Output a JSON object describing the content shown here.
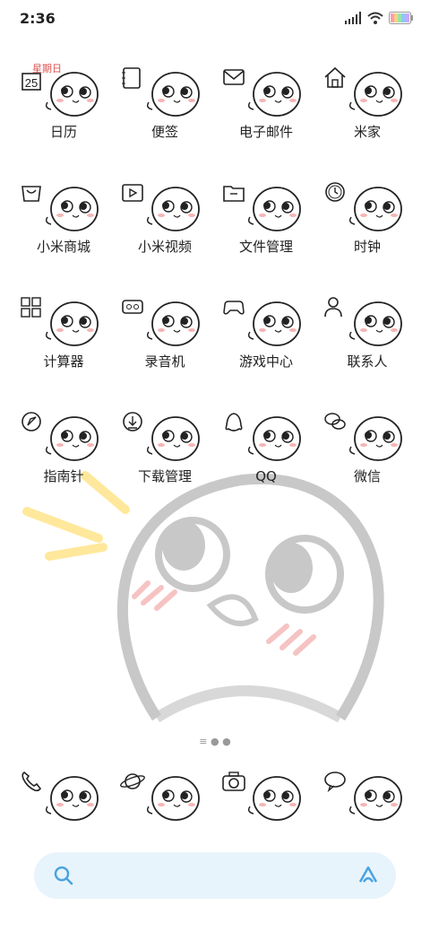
{
  "status_bar": {
    "time": "2:36"
  },
  "calendar_date": "星期日",
  "calendar_day": "25",
  "apps": [
    {
      "label": "日历",
      "icon": "calendar-icon"
    },
    {
      "label": "便签",
      "icon": "notes-icon"
    },
    {
      "label": "电子邮件",
      "icon": "mail-icon"
    },
    {
      "label": "米家",
      "icon": "home-icon"
    },
    {
      "label": "小米商城",
      "icon": "shopping-bag-icon"
    },
    {
      "label": "小米视频",
      "icon": "video-icon"
    },
    {
      "label": "文件管理",
      "icon": "folder-icon"
    },
    {
      "label": "时钟",
      "icon": "clock-icon"
    },
    {
      "label": "计算器",
      "icon": "calculator-icon"
    },
    {
      "label": "录音机",
      "icon": "recorder-icon"
    },
    {
      "label": "游戏中心",
      "icon": "gamepad-icon"
    },
    {
      "label": "联系人",
      "icon": "contacts-icon"
    },
    {
      "label": "指南针",
      "icon": "compass-icon"
    },
    {
      "label": "下载管理",
      "icon": "download-icon"
    },
    {
      "label": "QQ",
      "icon": "qq-icon"
    },
    {
      "label": "微信",
      "icon": "wechat-icon"
    }
  ],
  "dock": [
    {
      "label": "电话",
      "icon": "phone-icon"
    },
    {
      "label": "浏览器",
      "icon": "browser-icon"
    },
    {
      "label": "相机",
      "icon": "camera-icon"
    },
    {
      "label": "短信",
      "icon": "messages-icon"
    }
  ]
}
